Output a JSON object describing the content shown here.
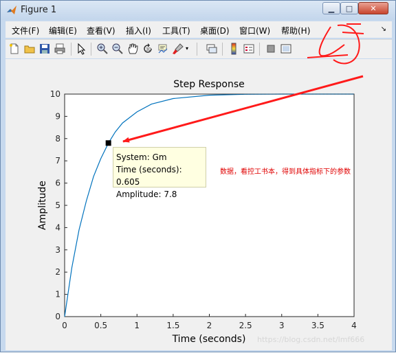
{
  "window": {
    "title": "Figure 1",
    "buttons": {
      "minimize": "▁",
      "maximize": "□",
      "close": "✕"
    }
  },
  "menu": {
    "items": [
      "文件(F)",
      "编辑(E)",
      "查看(V)",
      "插入(I)",
      "工具(T)",
      "桌面(D)",
      "窗口(W)",
      "帮助(H)"
    ]
  },
  "toolbar": {
    "icons": [
      "new-figure-icon",
      "open-file-icon",
      "save-figure-icon",
      "print-figure-icon",
      "edit-plot-icon",
      "zoom-in-icon",
      "zoom-out-icon",
      "pan-icon",
      "rotate-3d-icon",
      "data-cursor-icon",
      "brush-icon",
      "link-plot-icon",
      "colorbar-icon",
      "legend-icon",
      "hide-plot-tools-icon",
      "show-plot-tools-icon"
    ]
  },
  "chart_data": {
    "type": "line",
    "title": "Step Response",
    "xlabel": "Time (seconds)",
    "ylabel": "Amplitude",
    "xlim": [
      0,
      4
    ],
    "ylim": [
      0,
      10
    ],
    "xticks": [
      "0",
      "0.5",
      "1",
      "1.5",
      "2",
      "2.5",
      "3",
      "3.5",
      "4"
    ],
    "yticks": [
      "0",
      "1",
      "2",
      "3",
      "4",
      "5",
      "6",
      "7",
      "8",
      "9",
      "10"
    ],
    "x": [
      0,
      0.1,
      0.2,
      0.3,
      0.4,
      0.5,
      0.605,
      0.7,
      0.8,
      1.0,
      1.2,
      1.5,
      2.0,
      2.5,
      3.0,
      3.5,
      4.0
    ],
    "y": [
      0,
      2.2,
      3.9,
      5.2,
      6.3,
      7.1,
      7.8,
      8.3,
      8.7,
      9.2,
      9.55,
      9.8,
      9.95,
      9.99,
      10,
      10,
      10
    ],
    "steady_state": 10,
    "color": "#0072bd",
    "grid": false
  },
  "datatip": {
    "x": 0.605,
    "y": 7.8,
    "line1": "System: Gm",
    "line2": "Time (seconds): 0.605",
    "line3": "Amplitude: 7.8"
  },
  "annotation": {
    "text": "数据，看控工书本，得到具体指标下的参数",
    "color": "#e00000"
  },
  "watermark": "https://blog.csdn.net/lmf666"
}
